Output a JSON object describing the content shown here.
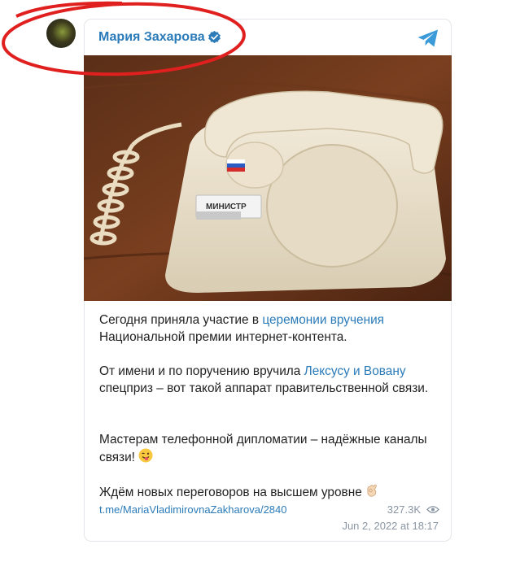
{
  "post": {
    "channel_name": "Мария Захарова",
    "paragraphs": {
      "p1_before": "Сегодня приняла участие в ",
      "p1_link": "церемонии вручения",
      "p1_after": " Национальной премии интернет-контента.",
      "p2_before": "От имени и по поручению вручила ",
      "p2_link": "Лексусу и Вовану",
      "p2_after": " спецприз – вот такой аппарат правительственной связи.",
      "p3": "Мастерам телефонной дипломатии – надёжные каналы связи!",
      "p4": "Ждём новых переговоров на высшем уровне"
    },
    "phone_label": "МИНИСТР",
    "source_link": "t.me/MariaVladimirovnaZakharova/2840",
    "views": "327.3K",
    "date": "Jun 2, 2022 at 18:17"
  },
  "icons": {
    "verified": "verified-badge-icon",
    "telegram": "telegram-plane-icon",
    "views": "eye-icon",
    "emoji_tongue": "winking-tongue-emoji",
    "emoji_ok": "ok-hand-emoji"
  },
  "colors": {
    "link": "#2b7bb9",
    "meta": "#8a96a3",
    "annotation": "#e0201f"
  }
}
